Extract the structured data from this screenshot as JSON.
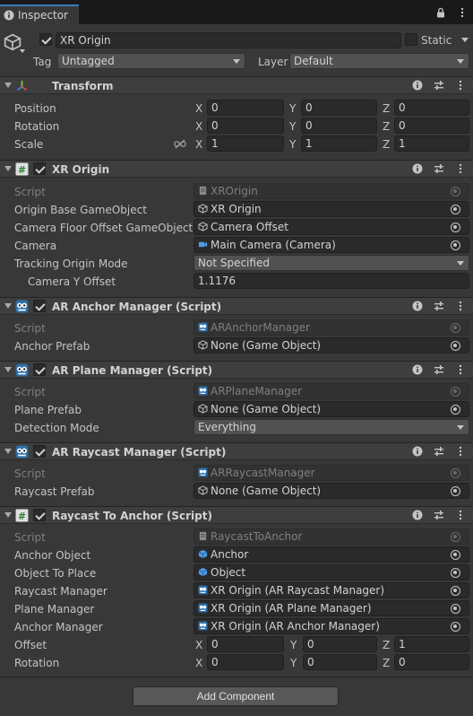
{
  "tab": {
    "label": "Inspector"
  },
  "object": {
    "name": "XR Origin",
    "static_label": "Static",
    "tag_label": "Tag",
    "tag_value": "Untagged",
    "layer_label": "Layer",
    "layer_value": "Default"
  },
  "axes": {
    "x": "X",
    "y": "Y",
    "z": "Z"
  },
  "transform": {
    "title": "Transform",
    "position_label": "Position",
    "rotation_label": "Rotation",
    "scale_label": "Scale",
    "position": [
      "0",
      "0",
      "0"
    ],
    "rotation": [
      "0",
      "0",
      "0"
    ],
    "scale": [
      "1",
      "1",
      "1"
    ]
  },
  "xr_origin": {
    "title": "XR Origin",
    "script_label": "Script",
    "script_value": "XROrigin",
    "origin_base_label": "Origin Base GameObject",
    "origin_base_value": "XR Origin",
    "camera_floor_label": "Camera Floor Offset GameObject",
    "camera_floor_value": "Camera Offset",
    "camera_label": "Camera",
    "camera_value": "Main Camera (Camera)",
    "tracking_mode_label": "Tracking Origin Mode",
    "tracking_mode_value": "Not Specified",
    "camera_y_label": "Camera Y Offset",
    "camera_y_value": "1.1176"
  },
  "anchor_manager": {
    "title": "AR Anchor Manager (Script)",
    "script_label": "Script",
    "script_value": "ARAnchorManager",
    "prefab_label": "Anchor Prefab",
    "prefab_value": "None (Game Object)"
  },
  "plane_manager": {
    "title": "AR Plane Manager (Script)",
    "script_label": "Script",
    "script_value": "ARPlaneManager",
    "prefab_label": "Plane Prefab",
    "prefab_value": "None (Game Object)",
    "detection_label": "Detection Mode",
    "detection_value": "Everything"
  },
  "raycast_manager": {
    "title": "AR Raycast Manager (Script)",
    "script_label": "Script",
    "script_value": "ARRaycastManager",
    "prefab_label": "Raycast Prefab",
    "prefab_value": "None (Game Object)"
  },
  "raycast_to_anchor": {
    "title": "Raycast To Anchor (Script)",
    "script_label": "Script",
    "script_value": "RaycastToAnchor",
    "anchor_object_label": "Anchor Object",
    "anchor_object_value": "Anchor",
    "object_to_place_label": "Object To Place",
    "object_to_place_value": "Object",
    "raycast_manager_label": "Raycast Manager",
    "raycast_manager_value": "XR Origin (AR Raycast Manager)",
    "plane_manager_label": "Plane Manager",
    "plane_manager_value": "XR Origin (AR Plane Manager)",
    "anchor_manager_label": "Anchor Manager",
    "anchor_manager_value": "XR Origin (AR Anchor Manager)",
    "offset_label": "Offset",
    "offset": [
      "0",
      "0",
      "1"
    ],
    "rotation_label": "Rotation",
    "rotation": [
      "0",
      "0",
      "0"
    ]
  },
  "add_component_label": "Add Component"
}
